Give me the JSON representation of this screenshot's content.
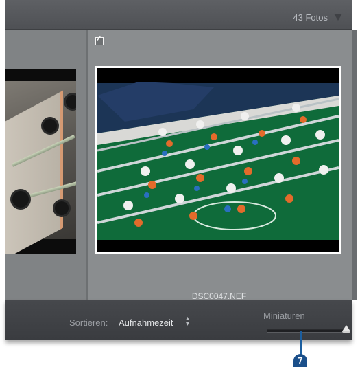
{
  "header": {
    "photo_count": "43 Fotos",
    "dropdown_icon": "triangle-down-icon"
  },
  "grid": {
    "cells": [
      {
        "type": "thumbnail",
        "description": "partial"
      },
      {
        "type": "thumbnail",
        "selected": true,
        "flagged": true,
        "filename": "DSC0047.NEF"
      }
    ]
  },
  "toolbar": {
    "sort_label": "Sortieren:",
    "sort_value": "Aufnahmezeit",
    "sort_icon": "up-down-arrows-icon",
    "thumbnail_label": "Miniaturen",
    "thumbnail_size_level": 1.0
  },
  "callout": {
    "number": "7"
  },
  "colors": {
    "panel": "#7f8284",
    "toolbar": "#3e4044",
    "selection_border": "#ffffff",
    "callout": "#1b4f8a"
  }
}
